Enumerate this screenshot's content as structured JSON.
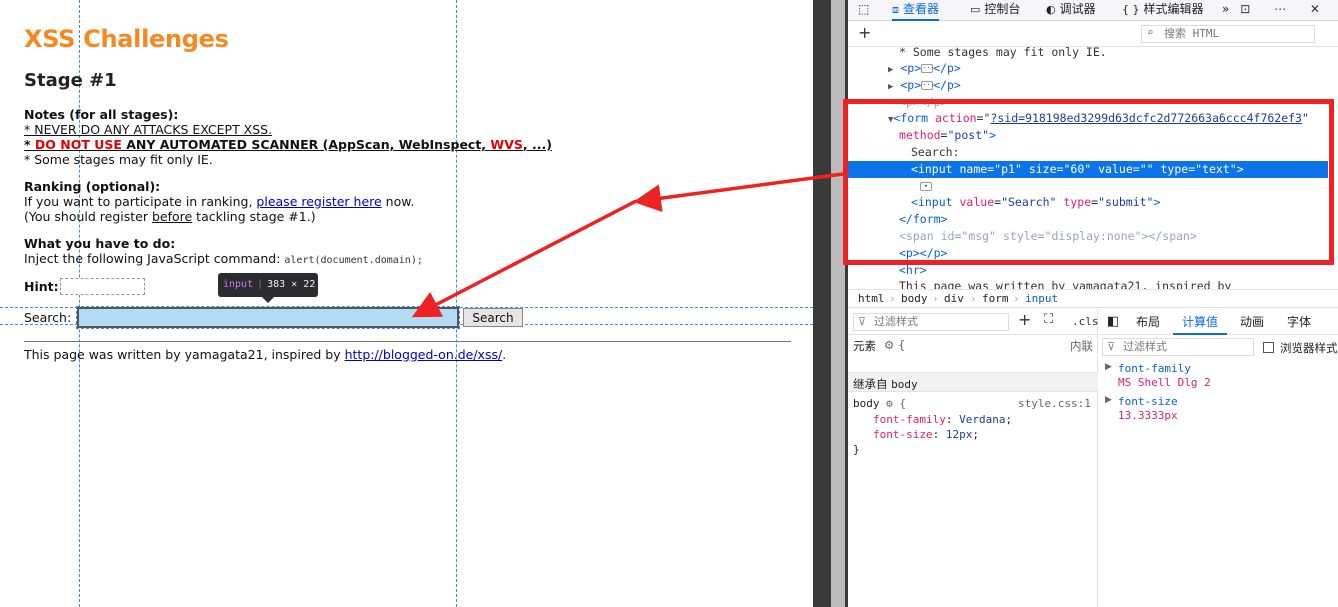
{
  "page": {
    "title": "XSS Challenges",
    "stage": "Stage #1",
    "notes_heading": "Notes (for all stages):",
    "note1": "* NEVER DO ANY ATTACKS EXCEPT XSS.",
    "note2_prefix": "* ",
    "note2_red": "DO NOT USE",
    "note2_mid": " ANY AUTOMATED SCANNER (AppScan, WebInspect, ",
    "note2_wvs": "WVS",
    "note2_end": ", ...)",
    "note3": "* Some stages may fit only IE.",
    "ranking_heading": "Ranking (optional):",
    "ranking_line1_pre": "If you want to participate in ranking, ",
    "ranking_link": "please register here",
    "ranking_line1_post": " now.",
    "ranking_line2_pre": "(You should register ",
    "ranking_line2_u": "before",
    "ranking_line2_post": " tackling stage #1.)",
    "todo_heading": "What you have to do:",
    "todo_text": "Inject the following JavaScript command: ",
    "todo_code": "alert(document.domain);",
    "hint_label": "Hint:",
    "search_label": "Search:",
    "search_value": "",
    "search_button": "Search",
    "footer_pre": "This page was written by yamagata21, inspired by ",
    "footer_link": "http://blogged-on.de/xss/",
    "footer_post": "."
  },
  "tooltip": {
    "tag": "input",
    "width": "383",
    "times": "×",
    "height": "22"
  },
  "devtools": {
    "tabs": [
      {
        "label": "查看器",
        "icon": "inspector-icon"
      },
      {
        "label": "控制台",
        "icon": "console-icon"
      },
      {
        "label": "调试器",
        "icon": "debugger-icon"
      },
      {
        "label": "样式编辑器",
        "icon": "style-editor-icon"
      }
    ],
    "tabs_icons": {
      "pick": "⬚",
      "inspector": "⧈",
      "console": "▭",
      "debugger": "◐",
      "style": "{ }",
      "more": "»"
    },
    "actions": "⊡ ⋯ ✕",
    "add": "+",
    "search_placeholder": "搜索 HTML",
    "tree": {
      "l0": "* Some stages may fit only IE.",
      "l1_open": "<p>",
      "l1_close": "</p>",
      "l2_open": "<p>",
      "l2_close": "</p>",
      "l3": "<p></p>",
      "form_tag": "form",
      "form_attr1": "action",
      "form_val1": "?sid=918198ed3299d63dcfc2d772663a6ccc4f762ef3",
      "form_attr2": "method",
      "form_val2": "post",
      "search_text": "Search:",
      "input_tag": "input",
      "input_a1": "name",
      "input_v1": "p1",
      "input_a2": "size",
      "input_v2": "60",
      "input_a3": "value",
      "input_v3": "",
      "input_a4": "type",
      "input_v4": "text",
      "input2_a1": "value",
      "input2_v1": "Search",
      "input2_a2": "type",
      "input2_v2": "submit",
      "form_close": "</form>",
      "span_tag": "span",
      "span_a1": "id",
      "span_v1": "msg",
      "span_a2": "style",
      "span_v2": "display:none",
      "p_empty": "<p></p>",
      "hr": "<hr>",
      "footer_text": "This page was written by yamagata21, inspired by"
    },
    "breadcrumbs": [
      "html",
      "body",
      "div",
      "form",
      "input"
    ],
    "rules": {
      "filter_placeholder": "过滤样式",
      "cls": ".cls",
      "element": "元素",
      "inline": "内联",
      "inherited": "继承自",
      "inherited_from": "body",
      "selector": "body",
      "source": "style.css:1",
      "p1": "font-family",
      "v1": "Verdana",
      "p2": "font-size",
      "v2": "12px"
    },
    "computed": {
      "tabs": [
        "布局",
        "计算值",
        "动画",
        "字体"
      ],
      "active_tab": "计算值",
      "filter_placeholder": "过滤样式",
      "browser_styles": "浏览器样式",
      "props": [
        {
          "name": "font-family",
          "value": "MS Shell Dlg 2"
        },
        {
          "name": "font-size",
          "value": "13.3333px"
        }
      ]
    }
  },
  "annotation_color": "#ee2222"
}
